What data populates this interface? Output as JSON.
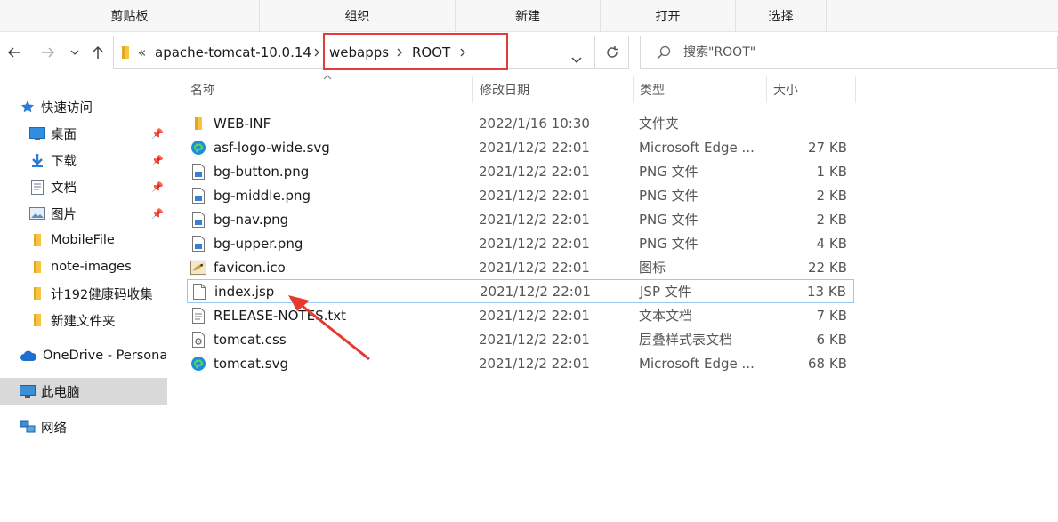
{
  "ribbon": {
    "groups": [
      "剪贴板",
      "组织",
      "新建",
      "打开",
      "选择"
    ]
  },
  "address": {
    "overflow": "«",
    "crumbs": [
      "apache-tomcat-10.0.14",
      "webapps",
      "ROOT"
    ]
  },
  "search": {
    "placeholder": "搜索\"ROOT\""
  },
  "sidebar": {
    "quick_access": "快速访问",
    "items": [
      {
        "label": "桌面",
        "icon": "desktop-icon",
        "pinned": true
      },
      {
        "label": "下载",
        "icon": "download-icon",
        "pinned": true
      },
      {
        "label": "文档",
        "icon": "document-icon",
        "pinned": true
      },
      {
        "label": "图片",
        "icon": "picture-icon",
        "pinned": true
      },
      {
        "label": "MobileFile",
        "icon": "folder-icon",
        "pinned": false
      },
      {
        "label": "note-images",
        "icon": "folder-icon",
        "pinned": false
      },
      {
        "label": "计192健康码收集",
        "icon": "folder-icon",
        "pinned": false
      },
      {
        "label": "新建文件夹",
        "icon": "folder-icon",
        "pinned": false
      }
    ],
    "onedrive": "OneDrive - Persona",
    "this_pc": "此电脑",
    "network": "网络"
  },
  "columns": {
    "name": "名称",
    "date": "修改日期",
    "type": "类型",
    "size": "大小"
  },
  "files": [
    {
      "name": "WEB-INF",
      "date": "2022/1/16 10:30",
      "type": "文件夹",
      "size": "",
      "icon": "folder-icon"
    },
    {
      "name": "asf-logo-wide.svg",
      "date": "2021/12/2 22:01",
      "type": "Microsoft Edge ...",
      "size": "27 KB",
      "icon": "edge-icon"
    },
    {
      "name": "bg-button.png",
      "date": "2021/12/2 22:01",
      "type": "PNG 文件",
      "size": "1 KB",
      "icon": "image-file-icon"
    },
    {
      "name": "bg-middle.png",
      "date": "2021/12/2 22:01",
      "type": "PNG 文件",
      "size": "2 KB",
      "icon": "image-file-icon"
    },
    {
      "name": "bg-nav.png",
      "date": "2021/12/2 22:01",
      "type": "PNG 文件",
      "size": "2 KB",
      "icon": "image-file-icon"
    },
    {
      "name": "bg-upper.png",
      "date": "2021/12/2 22:01",
      "type": "PNG 文件",
      "size": "4 KB",
      "icon": "image-file-icon"
    },
    {
      "name": "favicon.ico",
      "date": "2021/12/2 22:01",
      "type": "图标",
      "size": "22 KB",
      "icon": "tomcat-icon"
    },
    {
      "name": "index.jsp",
      "date": "2021/12/2 22:01",
      "type": "JSP 文件",
      "size": "13 KB",
      "icon": "blank-file-icon"
    },
    {
      "name": "RELEASE-NOTES.txt",
      "date": "2021/12/2 22:01",
      "type": "文本文档",
      "size": "7 KB",
      "icon": "text-file-icon"
    },
    {
      "name": "tomcat.css",
      "date": "2021/12/2 22:01",
      "type": "层叠样式表文档",
      "size": "6 KB",
      "icon": "css-file-icon"
    },
    {
      "name": "tomcat.svg",
      "date": "2021/12/2 22:01",
      "type": "Microsoft Edge ...",
      "size": "68 KB",
      "icon": "edge-icon"
    }
  ],
  "colors": {
    "highlight": "#e23b3b",
    "selection_border": "#99c9f1",
    "folder": "#f5c542",
    "edge": "#1e8fd6"
  }
}
